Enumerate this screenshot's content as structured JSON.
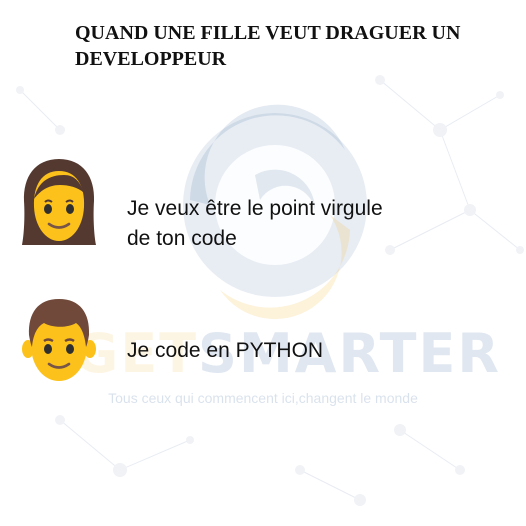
{
  "title": "QUAND UNE FILLE VEUT DRAGUER UN DEVELOPPEUR",
  "watermark": {
    "brand_prefix": "GET",
    "brand_suffix": "SMARTER",
    "tagline": "Tous ceux qui commencent ici,changent le monde"
  },
  "dialogue": [
    {
      "speaker_icon": "woman-emoji-icon",
      "text_line1": "Je veux être le point virgule",
      "text_line2": "de ton code"
    },
    {
      "speaker_icon": "man-emoji-icon",
      "text_line1": "Je code en PYTHON"
    }
  ],
  "colors": {
    "skin": "#fcc21b",
    "girl_hair": "#543930",
    "boy_hair": "#70493a",
    "watermark_blue": "#1d4f8f",
    "watermark_gold": "#f2b830"
  }
}
